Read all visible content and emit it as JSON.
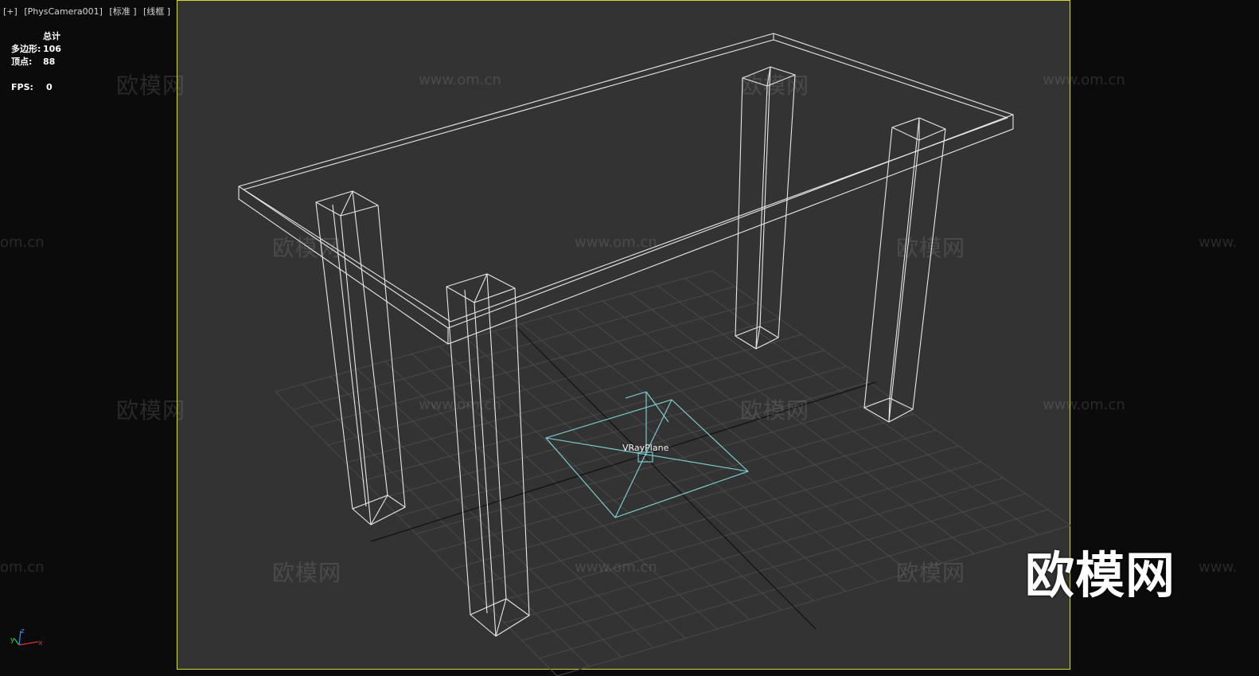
{
  "viewport_label": {
    "menu": "[+]",
    "camera": "[PhysCamera001]",
    "shading": "[标准 ]",
    "mode": "[线框 ]"
  },
  "stats": {
    "header": "总计",
    "polygons_label": "多边形:",
    "polygons": "106",
    "vertices_label": "顶点:",
    "vertices": "88",
    "fps_label": "FPS:",
    "fps": "0"
  },
  "object_label": "VRayPlane",
  "watermark": {
    "cn": "欧模网",
    "url": "www.om.cn",
    "url_left": "om.cn",
    "url_right": "www."
  },
  "brand": "欧模网",
  "axes": {
    "x": "x",
    "y": "y",
    "z": "z"
  },
  "colors": {
    "viewport_bg": "#333333",
    "viewport_border": "#d7d82a",
    "wireframe": "#e8e8e8",
    "grid": "#4a4a4a",
    "selected": "#7fd6d8"
  }
}
